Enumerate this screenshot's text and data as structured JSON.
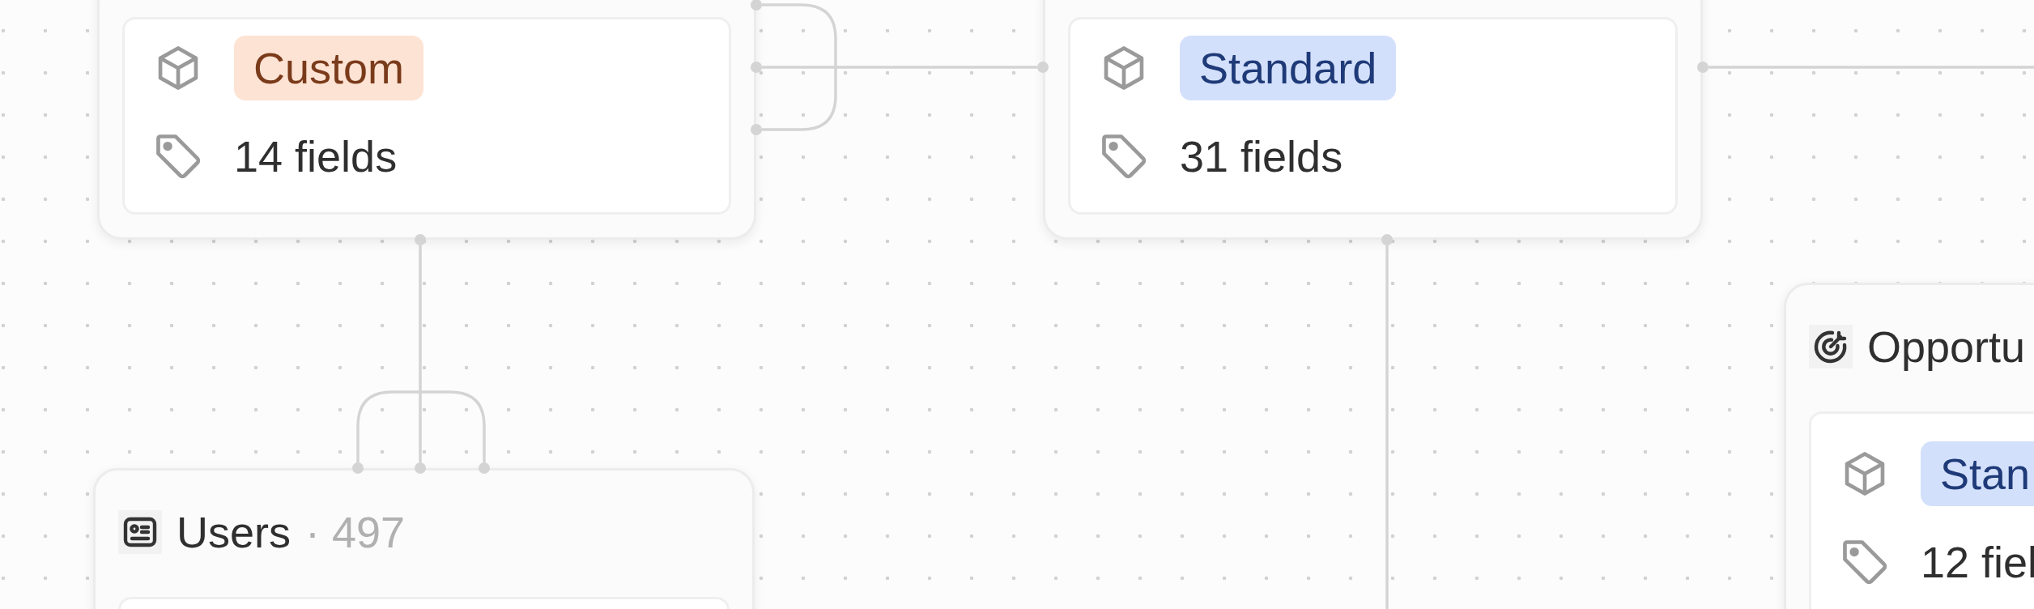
{
  "nodes": [
    {
      "badge": {
        "label": "Custom",
        "kind": "custom"
      },
      "fields": "14 fields"
    },
    {
      "badge": {
        "label": "Standard",
        "kind": "standard"
      },
      "fields": "31 fields"
    },
    {
      "title": "Users",
      "count": "· 497"
    },
    {
      "title": "Opportu",
      "badge": {
        "label": "Stan",
        "kind": "standard"
      },
      "fields": "12 fiel"
    }
  ]
}
